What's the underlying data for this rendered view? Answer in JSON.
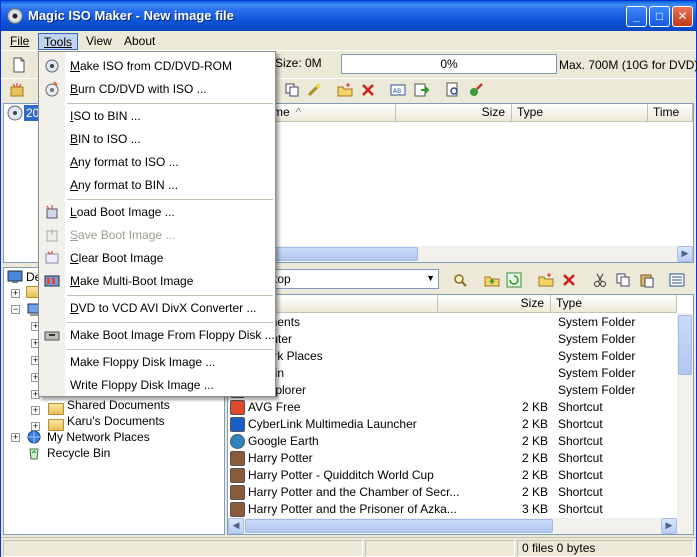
{
  "window": {
    "title": "Magic ISO Maker - New image file",
    "min": "_",
    "max": "□",
    "close": "✕"
  },
  "menubar": [
    "File",
    "Tools",
    "View",
    "About"
  ],
  "iso_toolbar": {
    "size_label": "Size: 0M",
    "progress_text": "0%",
    "progress_value": 0,
    "max_text": "Max. 700M (10G for DVD)"
  },
  "image_list": {
    "root_item": "20",
    "columns": [
      "me",
      "Size",
      "Type",
      "Time"
    ]
  },
  "tree": {
    "root_label": "De",
    "items": [
      {
        "label": "Shared Documents",
        "indent": 2,
        "icon": "folder-icon",
        "expander": "+"
      },
      {
        "label": "Karu's Documents",
        "indent": 2,
        "icon": "folder-icon",
        "expander": "+"
      },
      {
        "label": "My Network Places",
        "indent": 1,
        "icon": "network-icon",
        "expander": "+"
      },
      {
        "label": "Recycle Bin",
        "indent": 1,
        "icon": "recycle-bin-icon",
        "expander": ""
      }
    ]
  },
  "path_combo": {
    "value": "top"
  },
  "file_list": {
    "columns": [
      "",
      "Size",
      "Type"
    ],
    "rows": [
      {
        "name": "ocuments",
        "size": "",
        "type": "System Folder",
        "icon": "folder-icon"
      },
      {
        "name": "omputer",
        "size": "",
        "type": "System Folder",
        "icon": "computer-icon"
      },
      {
        "name": "etwork Places",
        "size": "",
        "type": "System Folder",
        "icon": "network-icon"
      },
      {
        "name": "cle Bin",
        "size": "",
        "type": "System Folder",
        "icon": "recycle-bin-icon"
      },
      {
        "name": "et Explorer",
        "size": "",
        "type": "System Folder",
        "icon": "ie-icon"
      },
      {
        "name": "AVG Free",
        "size": "2 KB",
        "type": "Shortcut",
        "icon": "avg-icon"
      },
      {
        "name": "CyberLink Multimedia Launcher",
        "size": "2 KB",
        "type": "Shortcut",
        "icon": "cyberlink-icon"
      },
      {
        "name": "Google Earth",
        "size": "2 KB",
        "type": "Shortcut",
        "icon": "globe-icon"
      },
      {
        "name": "Harry Potter",
        "size": "2 KB",
        "type": "Shortcut",
        "icon": "game-icon"
      },
      {
        "name": "Harry Potter - Quidditch World Cup",
        "size": "2 KB",
        "type": "Shortcut",
        "icon": "game-icon"
      },
      {
        "name": "Harry Potter and the Chamber of Secr...",
        "size": "2 KB",
        "type": "Shortcut",
        "icon": "game-icon"
      },
      {
        "name": "Harry Potter and the Prisoner of Azka...",
        "size": "3 KB",
        "type": "Shortcut",
        "icon": "game-icon"
      }
    ]
  },
  "status": {
    "files": "0 files  0 bytes"
  },
  "tools_menu": {
    "items": [
      {
        "label": "Make ISO from CD/DVD-ROM",
        "ul": "M",
        "rest": "ake ISO from CD/DVD-ROM",
        "icon": "cd-drive-icon",
        "disabled": false
      },
      {
        "label": "Burn CD/DVD with ISO ...",
        "ul": "B",
        "rest": "urn CD/DVD with ISO ...",
        "icon": "burn-disc-icon",
        "disabled": false
      },
      {
        "sep": true
      },
      {
        "label": "ISO to BIN ...",
        "ul": "I",
        "rest": "SO to BIN ...",
        "icon": "",
        "disabled": false
      },
      {
        "label": "BIN to ISO ...",
        "ul": "B",
        "rest": "IN to ISO ...",
        "icon": "",
        "disabled": false
      },
      {
        "label": "Any format to ISO ...",
        "ul": "A",
        "rest": "ny format to ISO ...",
        "icon": "",
        "disabled": false
      },
      {
        "label": "Any format to BIN ...",
        "ul": "A",
        "rest": "ny format to BIN ...",
        "icon": "",
        "disabled": false
      },
      {
        "sep": true
      },
      {
        "label": "Load Boot Image ...",
        "ul": "L",
        "rest": "oad Boot Image ...",
        "icon": "load-boot-icon",
        "disabled": false
      },
      {
        "label": "Save Boot Image ...",
        "ul": "S",
        "rest": "ave Boot Image ...",
        "icon": "save-boot-icon",
        "disabled": true
      },
      {
        "label": "Clear Boot Image",
        "ul": "C",
        "rest": "lear Boot Image",
        "icon": "clear-boot-icon",
        "disabled": false
      },
      {
        "label": "Make Multi-Boot Image",
        "ul": "M",
        "rest": "ake Multi-Boot Image",
        "icon": "multiboot-icon",
        "disabled": false
      },
      {
        "sep": true
      },
      {
        "label": "DVD to VCD AVI DivX Converter ...",
        "ul": "D",
        "rest": "VD to VCD AVI DivX Converter ...",
        "icon": "",
        "disabled": false
      },
      {
        "sep": true
      },
      {
        "label": "Make Boot Image From Floppy Disk ...",
        "ul": "",
        "rest": "Make Boot Image From Floppy Disk ...",
        "icon": "floppy-drive-icon",
        "disabled": false
      },
      {
        "sep": true
      },
      {
        "label": "Make Floppy Disk Image ...",
        "ul": "",
        "rest": "Make Floppy Disk Image ...",
        "icon": "",
        "disabled": false
      },
      {
        "label": "Write Floppy Disk Image ...",
        "ul": "",
        "rest": "Write Floppy Disk Image ...",
        "icon": "",
        "disabled": false
      }
    ]
  },
  "colors": {
    "title_blue": "#0a53d6",
    "menu_highlight": "#c1d2ee",
    "disabled_text": "#9d9d93"
  }
}
